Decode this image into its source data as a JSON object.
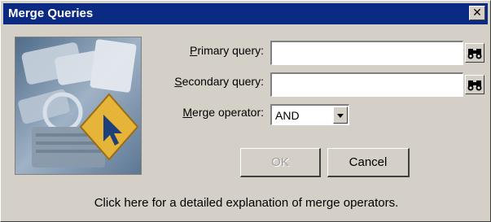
{
  "window": {
    "title": "Merge Queries",
    "close_glyph": "✕"
  },
  "form": {
    "primary_label_accel": "P",
    "primary_label_rest": "rimary query:",
    "primary_value": "",
    "secondary_label_accel": "S",
    "secondary_label_rest": "econdary query:",
    "secondary_value": "",
    "operator_label_accel": "M",
    "operator_label_rest": "erge operator:",
    "operator_value": "AND",
    "browse_icon": "binoculars-icon"
  },
  "buttons": {
    "ok_label": "OK",
    "cancel_label": "Cancel"
  },
  "help_text": "Click here for a detailed explanation of merge operators.",
  "colors": {
    "titlebar": "#0a2a84",
    "dialog_bg": "#d4d0c8",
    "accent_sign": "#e7b43a"
  }
}
